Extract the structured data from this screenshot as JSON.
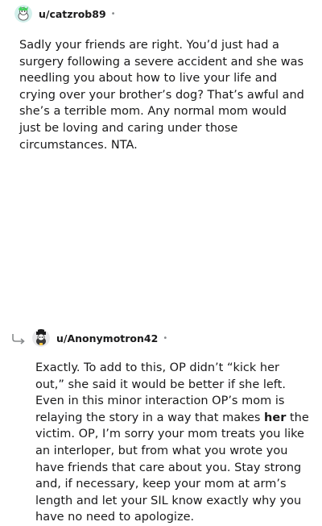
{
  "comments": [
    {
      "username": "u/catzrob89",
      "separator": "•",
      "avatar_icon": "snoo-avatar-icon",
      "body": "Sadly your friends are right. You’d just had a surgery following a severe accident and she was needling you about how to live your life and crying over your brother’s dog? That’s awful and she’s a terrible mom. Any normal mom would just be loving and caring under those circumstances. NTA."
    },
    {
      "username": "u/Anonymotron42",
      "separator": "•",
      "avatar_icon": "snoo-avatar-icon",
      "reply_icon": "reply-arrow-icon",
      "body_part1": "Exactly. To add to this, OP didn’t “kick her out,” she said it would be better if she left. Even in this minor interaction OP’s mom is relaying the story in a way that makes ",
      "body_bold": "her",
      "body_part2": " the victim. OP, I’m sorry your mom treats you like an interloper, but from what you wrote you have friends that care about you. Stay strong and, if necessary, keep your mom at arm’s length and let your SIL know exactly why you have no need to apologize."
    }
  ],
  "colors": {
    "text": "#1a1a1b",
    "meta": "#878a8c",
    "avatar1_bg": "#d4f0ec",
    "avatar2_bg": "#e8e8ea"
  }
}
